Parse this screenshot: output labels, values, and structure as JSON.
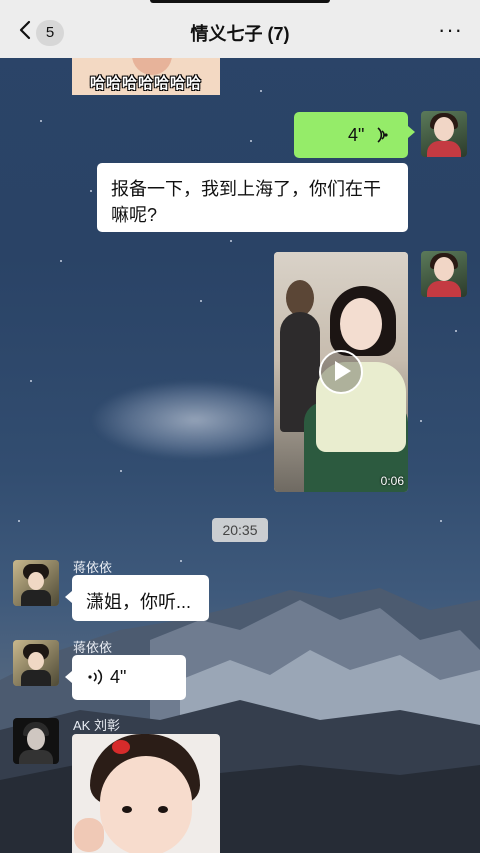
{
  "header": {
    "unread_count": "5",
    "title": "情义七子 (7)",
    "more": "···"
  },
  "messages": {
    "sticker_top_text": "哈哈哈哈哈哈哈",
    "voice_me": {
      "duration": "4\""
    },
    "text_me": {
      "line1": "报备一下，我到上海了，你们在干",
      "line2": "嘛呢?"
    },
    "video": {
      "duration": "0:06"
    },
    "timestamp": "20:35",
    "jiang_msg1": {
      "sender": "蒋依依",
      "text": "潇姐，你听..."
    },
    "jiang_msg2": {
      "sender": "蒋依依",
      "duration": "4\""
    },
    "ak_msg": {
      "sender": "AK 刘彰"
    }
  },
  "colors": {
    "bubble_green": "#95ec69",
    "bubble_white": "#ffffff",
    "header_bg": "#ededed"
  }
}
